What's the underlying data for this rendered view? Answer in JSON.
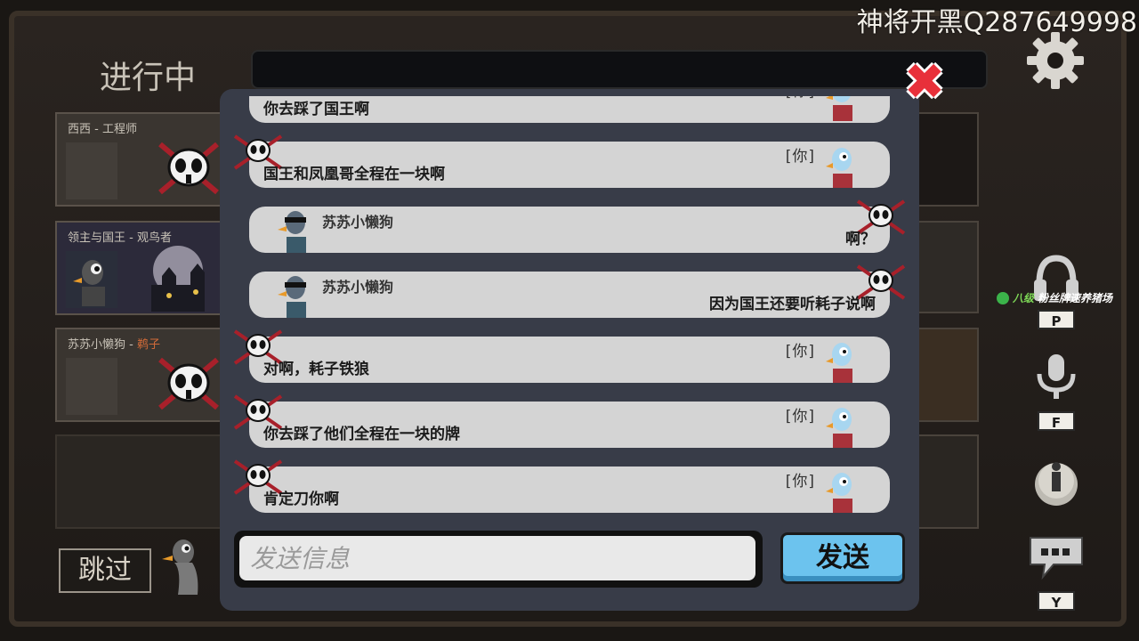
{
  "watermark": "神将开黑Q287649998",
  "header": {
    "title": "进行中"
  },
  "players": [
    {
      "name": "西西",
      "role": "工程师",
      "dead": true
    },
    {
      "name": "领主与国王",
      "role": "观鸟者",
      "dead": false
    },
    {
      "name": "苏苏小懒狗",
      "role": "鹈子",
      "dead": true
    }
  ],
  "chat": {
    "you_tag": "[你]",
    "messages": [
      {
        "from": "me",
        "text": "你去踩了国王啊"
      },
      {
        "from": "me",
        "text": "国王和凤凰哥全程在一块啊"
      },
      {
        "from": "other",
        "sender": "苏苏小懒狗",
        "text": "啊？"
      },
      {
        "from": "other",
        "sender": "苏苏小懒狗",
        "text": "因为国王还要听耗子说啊"
      },
      {
        "from": "me",
        "text": "对啊，耗子铁狼"
      },
      {
        "from": "me",
        "text": "你去踩了他们全程在一块的牌"
      },
      {
        "from": "me",
        "text": "肯定刀你啊"
      }
    ],
    "input_placeholder": "发送信息",
    "send_label": "发送"
  },
  "controls": {
    "skip_label": "跳过",
    "headset_key": "P",
    "mic_key": "F",
    "chat_key": "Y",
    "fan_badge": {
      "level": "八级",
      "text": "粉丝牌速养猪场"
    }
  },
  "colors": {
    "close": "#e8303a",
    "send_button": "#6cc3ee",
    "bubble": "#d4d4d4",
    "modal": "#383c48"
  }
}
